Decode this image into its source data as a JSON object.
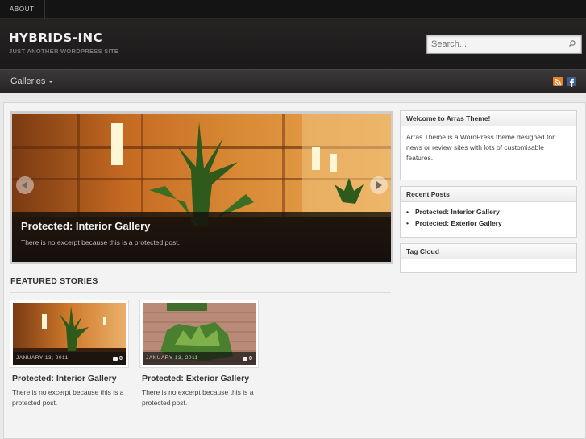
{
  "topnav": {
    "about": "ABOUT"
  },
  "site": {
    "title": "HYBRIDS-INC",
    "tagline": "JUST ANOTHER WORDPRESS SITE"
  },
  "search": {
    "placeholder": "Search..."
  },
  "menu": {
    "galleries": "Galleries"
  },
  "icons": {
    "rss": "rss-icon",
    "facebook": "facebook-icon",
    "search": "search-icon"
  },
  "colors": {
    "rss": "#e0832e",
    "facebook": "#3f5c8f"
  },
  "slideshow": {
    "title": "Protected: Interior Gallery",
    "excerpt": "There is no excerpt because this is a protected post."
  },
  "featured": {
    "heading": "FEATURED STORIES",
    "posts": [
      {
        "date": "JANUARY 13, 2011",
        "comments": "0",
        "title": "Protected: Interior Gallery",
        "excerpt": "There is no excerpt because this is a protected post."
      },
      {
        "date": "JANUARY 13, 2011",
        "comments": "0",
        "title": "Protected: Exterior Gallery",
        "excerpt": "There is no excerpt because this is a protected post."
      }
    ]
  },
  "sidebar": {
    "welcome": {
      "title": "Welcome to Arras Theme!",
      "body": "Arras Theme is a WordPress theme designed for news or review sites with lots of customisable features."
    },
    "recent": {
      "title": "Recent Posts",
      "items": [
        "Protected: Interior Gallery",
        "Protected: Exterior Gallery"
      ]
    },
    "tagcloud": {
      "title": "Tag Cloud"
    }
  }
}
